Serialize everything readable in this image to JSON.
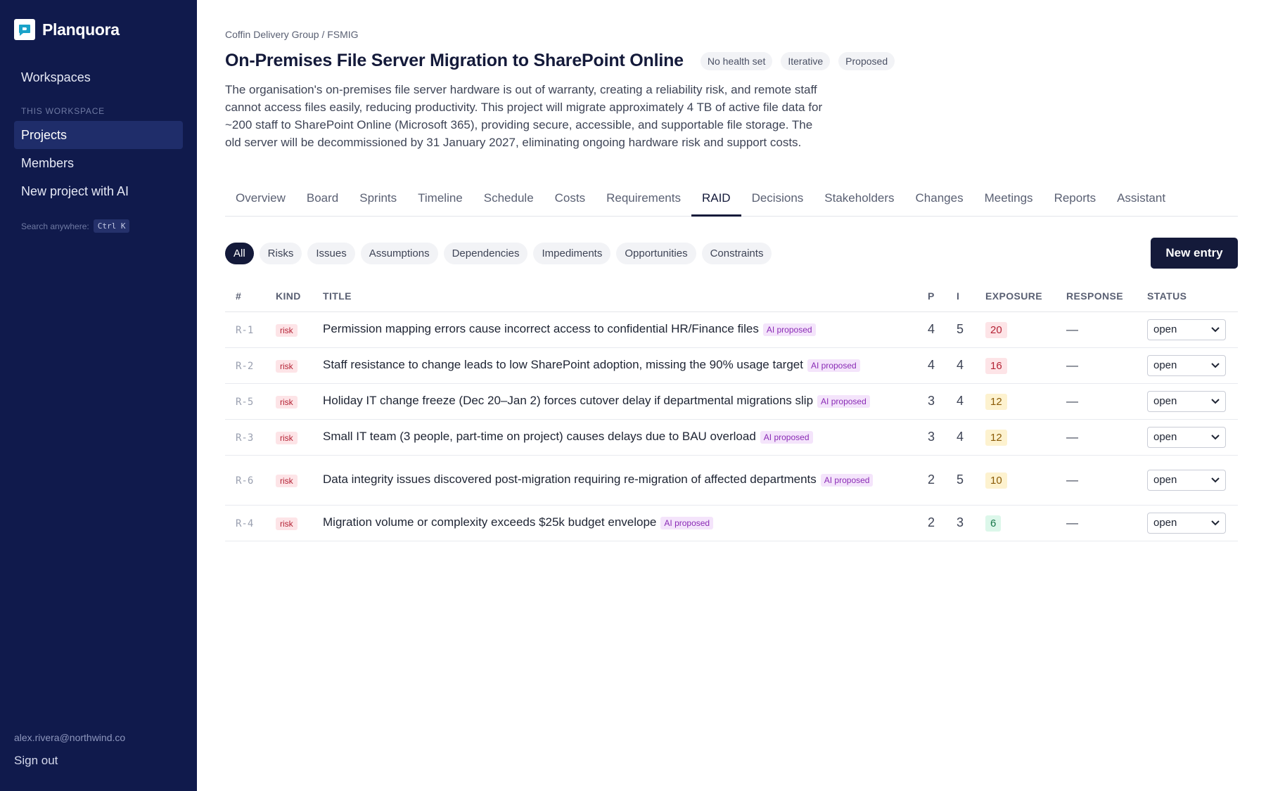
{
  "app": {
    "name": "Planquora",
    "logo_icon": "chat-bubble-logo-icon"
  },
  "sidebar": {
    "workspaces": "Workspaces",
    "section_label": "THIS WORKSPACE",
    "items": [
      {
        "label": "Projects",
        "active": true
      },
      {
        "label": "Members",
        "active": false
      },
      {
        "label": "New project with AI",
        "active": false
      }
    ],
    "search_hint": "Search anywhere:",
    "search_shortcut": "Ctrl K",
    "user_email": "alex.rivera@northwind.co",
    "sign_out": "Sign out"
  },
  "project": {
    "breadcrumb": "Coffin Delivery Group / FSMIG",
    "title": "On-Premises File Server Migration to SharePoint Online",
    "chips": [
      "No health set",
      "Iterative",
      "Proposed"
    ],
    "description": "The organisation's on-premises file server hardware is out of warranty, creating a reliability risk, and remote staff cannot access files easily, reducing productivity. This project will migrate approximately 4 TB of active file data for ~200 staff to SharePoint Online (Microsoft 365), providing secure, accessible, and supportable file storage. The old server will be decommissioned by 31 January 2027, eliminating ongoing hardware risk and support costs."
  },
  "tabs": [
    "Overview",
    "Board",
    "Sprints",
    "Timeline",
    "Schedule",
    "Costs",
    "Requirements",
    "RAID",
    "Decisions",
    "Stakeholders",
    "Changes",
    "Meetings",
    "Reports",
    "Assistant"
  ],
  "active_tab": "RAID",
  "filters": [
    "All",
    "Risks",
    "Issues",
    "Assumptions",
    "Dependencies",
    "Impediments",
    "Opportunities",
    "Constraints"
  ],
  "active_filter": "All",
  "new_entry_label": "New entry",
  "table": {
    "headers": [
      "#",
      "KIND",
      "TITLE",
      "P",
      "I",
      "EXPOSURE",
      "RESPONSE",
      "STATUS"
    ],
    "ai_badge": "AI proposed",
    "rows": [
      {
        "ref": "R-1",
        "kind": "risk",
        "title": "Permission mapping errors cause incorrect access to confidential HR/Finance files",
        "p": "4",
        "i": "5",
        "exposure": "20",
        "response": "—",
        "status": "open"
      },
      {
        "ref": "R-2",
        "kind": "risk",
        "title": "Staff resistance to change leads to low SharePoint adoption, missing the 90% usage target",
        "p": "4",
        "i": "4",
        "exposure": "16",
        "response": "—",
        "status": "open"
      },
      {
        "ref": "R-5",
        "kind": "risk",
        "title": "Holiday IT change freeze (Dec 20–Jan 2) forces cutover delay if departmental migrations slip",
        "p": "3",
        "i": "4",
        "exposure": "12",
        "response": "—",
        "status": "open"
      },
      {
        "ref": "R-3",
        "kind": "risk",
        "title": "Small IT team (3 people, part-time on project) causes delays due to BAU overload",
        "p": "3",
        "i": "4",
        "exposure": "12",
        "response": "—",
        "status": "open"
      },
      {
        "ref": "R-6",
        "kind": "risk",
        "title": "Data integrity issues discovered post-migration requiring re-migration of affected departments",
        "p": "2",
        "i": "5",
        "exposure": "10",
        "response": "—",
        "status": "open"
      },
      {
        "ref": "R-4",
        "kind": "risk",
        "title": "Migration volume or complexity exceeds $25k budget envelope",
        "p": "2",
        "i": "3",
        "exposure": "6",
        "response": "—",
        "status": "open"
      }
    ]
  },
  "colors": {
    "sidebar_bg": "#101a4c",
    "primary": "#141a3a",
    "exposure_high": "#fde4e7",
    "exposure_mid": "#fdf2cf",
    "exposure_low": "#dcf7ea",
    "ai_badge": "#f4e4fb"
  }
}
